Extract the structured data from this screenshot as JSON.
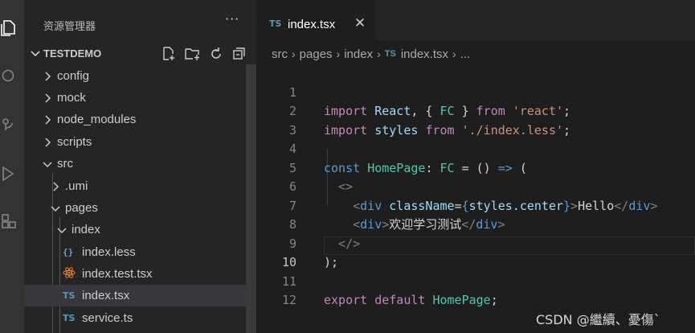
{
  "sidebar": {
    "title": "资源管理器",
    "more_label": "···",
    "project": "TESTDEMO",
    "tree": [
      {
        "label": "config",
        "kind": "folder",
        "expanded": false
      },
      {
        "label": "mock",
        "kind": "folder",
        "expanded": false
      },
      {
        "label": "node_modules",
        "kind": "folder",
        "expanded": false
      },
      {
        "label": "scripts",
        "kind": "folder",
        "expanded": false
      },
      {
        "label": "src",
        "kind": "folder",
        "expanded": true
      },
      {
        "label": ".umi",
        "kind": "folder",
        "expanded": false
      },
      {
        "label": "pages",
        "kind": "folder",
        "expanded": true
      },
      {
        "label": "index",
        "kind": "folder",
        "expanded": true
      },
      {
        "label": "index.less",
        "kind": "file",
        "icon": "{}"
      },
      {
        "label": "index.test.tsx",
        "kind": "file",
        "icon": "react"
      },
      {
        "label": "index.tsx",
        "kind": "file",
        "icon": "TS",
        "selected": true
      },
      {
        "label": "service.ts",
        "kind": "file",
        "icon": "TS"
      }
    ]
  },
  "tab": {
    "lang": "TS",
    "name": "index.tsx",
    "close": "✕"
  },
  "breadcrumb": {
    "parts": [
      "src",
      "pages",
      "index"
    ],
    "file_lang": "TS",
    "file": "index.tsx",
    "trail": "..."
  },
  "code": {
    "line_numbers": [
      "1",
      "2",
      "3",
      "4",
      "5",
      "6",
      "7",
      "8",
      "9",
      "10",
      "11",
      "12"
    ],
    "active_line": "10",
    "tokens": {
      "import": "import",
      "react_ident": "React",
      "fc": "FC",
      "from": "from",
      "react_str": "'react'",
      "styles": "styles",
      "less_str": "'./index.less'",
      "const": "const",
      "homepage": "HomePage",
      "div": "div",
      "classname": "className",
      "center": "center",
      "hello": "Hello",
      "cjk_text": "欢迎学习测试",
      "export": "export",
      "default": "default"
    }
  },
  "watermark": "CSDN @繼續、憂傷`",
  "colors": {
    "editor_bg": "#1e1e1e",
    "sidebar_bg": "#252526",
    "activity_bg": "#333333",
    "ts_icon": "#519aba",
    "keyword_control": "#c586c0",
    "keyword_storage": "#569cd6",
    "variable": "#9cdcfe",
    "string": "#ce9178",
    "type": "#4ec9b0"
  }
}
